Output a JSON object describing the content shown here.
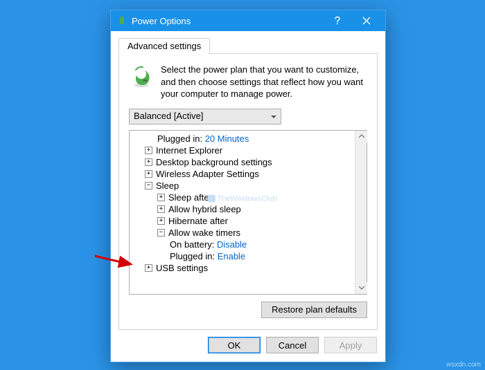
{
  "window": {
    "title": "Power Options",
    "help_tooltip": "Help",
    "close_tooltip": "Close"
  },
  "tab": {
    "label": "Advanced settings"
  },
  "intro": "Select the power plan that you want to customize, and then choose settings that reflect how you want your computer to manage power.",
  "plan_selected": "Balanced [Active]",
  "tree": {
    "plugged_in_top": {
      "label": "Plugged in:",
      "value": "20 Minutes"
    },
    "ie": "Internet Explorer",
    "desktop_bg": "Desktop background settings",
    "wireless": "Wireless Adapter Settings",
    "sleep": "Sleep",
    "sleep_after": "Sleep after",
    "hybrid": "Allow hybrid sleep",
    "hibernate": "Hibernate after",
    "wake_timers": "Allow wake timers",
    "wake_on_battery": {
      "label": "On battery:",
      "value": "Disable"
    },
    "wake_plugged_in": {
      "label": "Plugged in:",
      "value": "Enable"
    },
    "usb": "USB settings"
  },
  "watermark": "TheWindowsClub",
  "buttons": {
    "restore_defaults": "Restore plan defaults",
    "ok": "OK",
    "cancel": "Cancel",
    "apply": "Apply"
  },
  "page_watermark": "wsxdn.com"
}
